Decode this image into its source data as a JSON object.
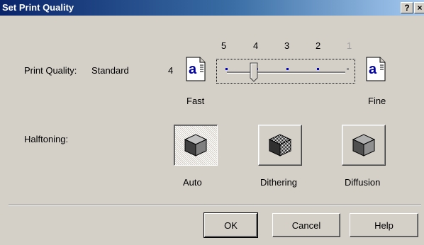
{
  "window": {
    "title": "Set Print Quality",
    "help_button": "?",
    "close_button": "×"
  },
  "print_quality": {
    "label": "Print Quality:",
    "mode": "Standard",
    "current_level": "4",
    "fast_label": "Fast",
    "fine_label": "Fine",
    "scale": [
      "5",
      "4",
      "3",
      "2",
      "1"
    ],
    "icon_glyph": "a",
    "slider_value": 4,
    "scale_colors": [
      "#000000",
      "#000000",
      "#000000",
      "#000000",
      "#a0a0a0"
    ]
  },
  "halftoning": {
    "label": "Halftoning:",
    "options": [
      {
        "label": "Auto",
        "selected": true
      },
      {
        "label": "Dithering",
        "selected": false
      },
      {
        "label": "Diffusion",
        "selected": false
      }
    ]
  },
  "buttons": {
    "ok": "OK",
    "cancel": "Cancel",
    "help": "Help"
  }
}
